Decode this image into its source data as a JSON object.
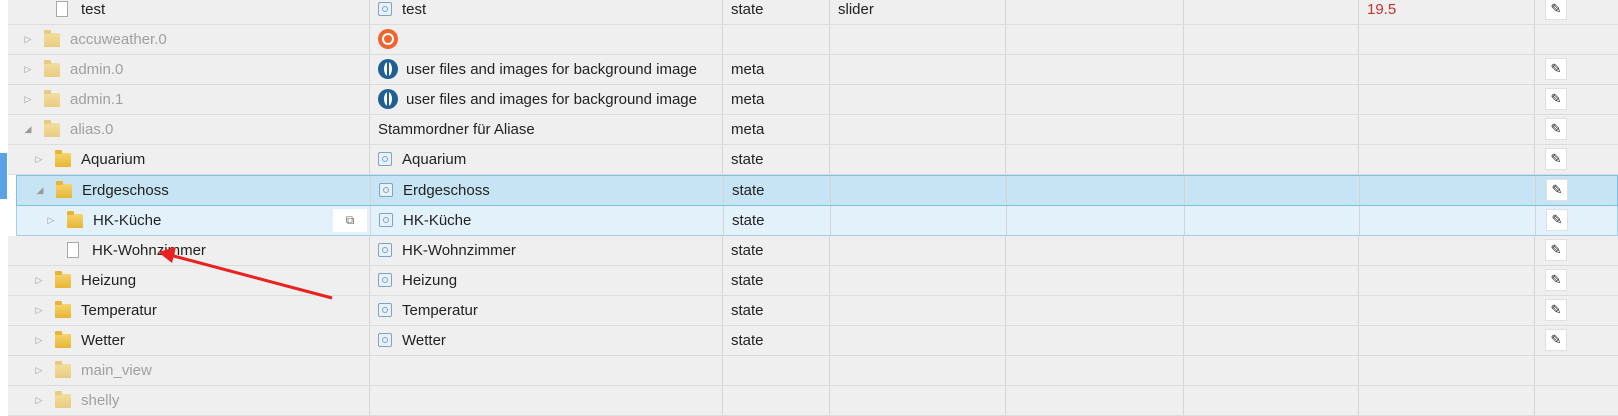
{
  "rows": [
    {
      "name": "test",
      "desc": "test",
      "type": "state",
      "role": "slider",
      "value": "19.5"
    },
    {
      "name": "accuweather.0"
    },
    {
      "name": "admin.0",
      "desc": "user files and images for background image",
      "type": "meta"
    },
    {
      "name": "admin.1",
      "desc": "user files and images for background image",
      "type": "meta"
    },
    {
      "name": "alias.0",
      "desc": "Stammordner für Aliase",
      "type": "meta"
    },
    {
      "name": "Aquarium",
      "desc": "Aquarium",
      "type": "state"
    },
    {
      "name": "Erdgeschoss",
      "desc": "Erdgeschoss",
      "type": "state"
    },
    {
      "name": "HK-Küche",
      "desc": "HK-Küche",
      "type": "state"
    },
    {
      "name": "HK-Wohnzimmer",
      "desc": "HK-Wohnzimmer",
      "type": "state"
    },
    {
      "name": "Heizung",
      "desc": "Heizung",
      "type": "state"
    },
    {
      "name": "Temperatur",
      "desc": "Temperatur",
      "type": "state"
    },
    {
      "name": "Wetter",
      "desc": "Wetter",
      "type": "state"
    },
    {
      "name": "main_view"
    },
    {
      "name": "shelly"
    }
  ],
  "icons": {
    "edit": "pencil-icon",
    "copy": "copy-icon",
    "expand": "triangle-right",
    "collapse": "triangle-down"
  },
  "colors": {
    "value_red": "#c8302c",
    "selection": "#c6e4f3",
    "annotation_arrow": "#e8231f"
  }
}
